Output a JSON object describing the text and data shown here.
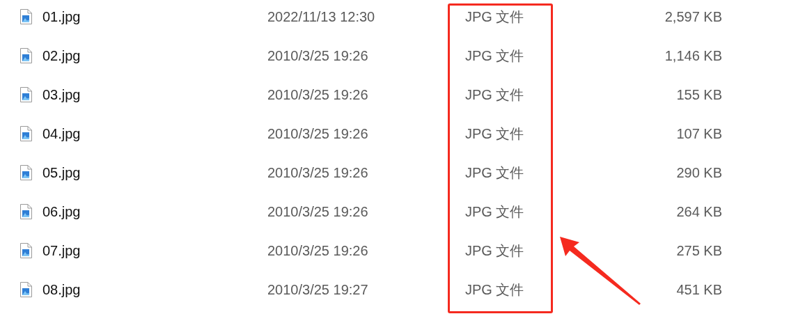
{
  "files": [
    {
      "name": "01.jpg",
      "modified": "2022/11/13 12:30",
      "type": "JPG 文件",
      "size": "2,597 KB"
    },
    {
      "name": "02.jpg",
      "modified": "2010/3/25 19:26",
      "type": "JPG 文件",
      "size": "1,146 KB"
    },
    {
      "name": "03.jpg",
      "modified": "2010/3/25 19:26",
      "type": "JPG 文件",
      "size": "155 KB"
    },
    {
      "name": "04.jpg",
      "modified": "2010/3/25 19:26",
      "type": "JPG 文件",
      "size": "107 KB"
    },
    {
      "name": "05.jpg",
      "modified": "2010/3/25 19:26",
      "type": "JPG 文件",
      "size": "290 KB"
    },
    {
      "name": "06.jpg",
      "modified": "2010/3/25 19:26",
      "type": "JPG 文件",
      "size": "264 KB"
    },
    {
      "name": "07.jpg",
      "modified": "2010/3/25 19:26",
      "type": "JPG 文件",
      "size": "275 KB"
    },
    {
      "name": "08.jpg",
      "modified": "2010/3/25 19:27",
      "type": "JPG 文件",
      "size": "451 KB"
    }
  ]
}
